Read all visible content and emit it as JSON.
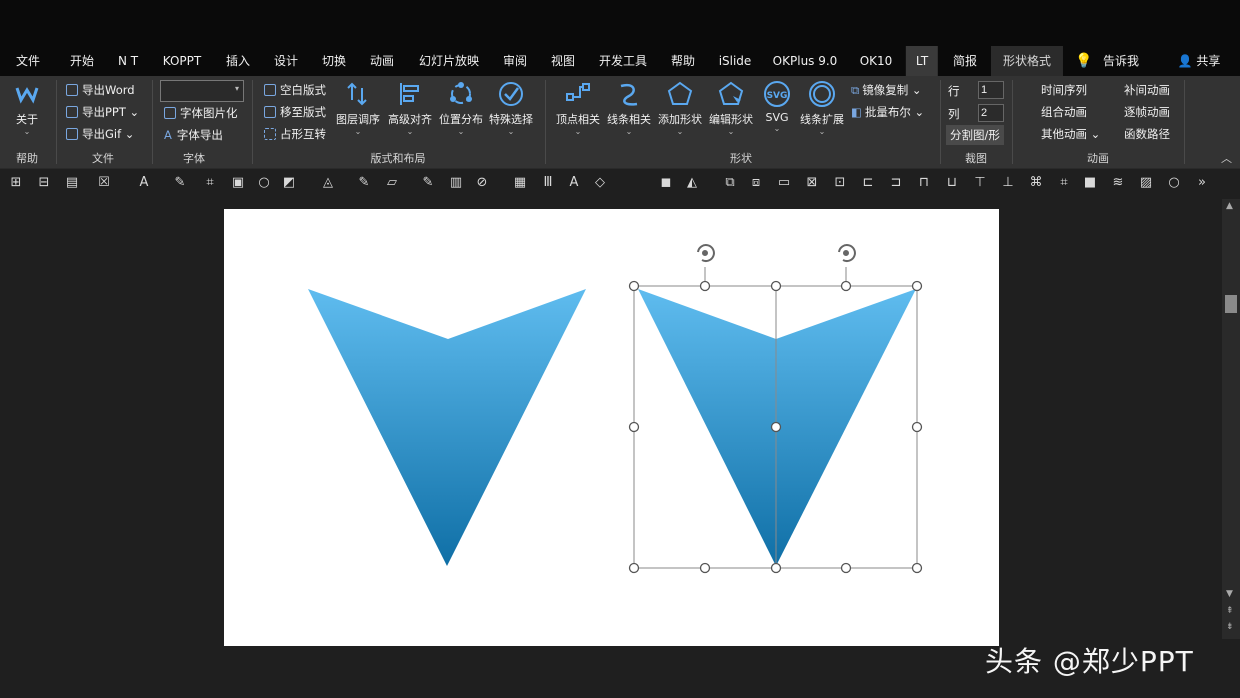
{
  "tabs": [
    "文件",
    "开始",
    "N T",
    "KOPPT",
    "插入",
    "设计",
    "切换",
    "动画",
    "幻灯片放映",
    "审阅",
    "视图",
    "开发工具",
    "帮助",
    "iSlide",
    "OKPlus 9.0",
    "OK10",
    "LT",
    "简报",
    "形状格式",
    "告诉我",
    "共享"
  ],
  "ribbon": {
    "help_group": {
      "about": "关于",
      "label": "帮助"
    },
    "file_group": {
      "export_word": "导出Word",
      "export_ppt": "导出PPT",
      "export_gif": "导出Gif",
      "label": "文件"
    },
    "font_group": {
      "font_image": "字体图片化",
      "font_export": "字体导出",
      "label": "字体"
    },
    "layout_group": {
      "blank_layout": "空白版式",
      "move_layout": "移至版式",
      "placeholder_swap": "占形互转",
      "layer_order": "图层调序",
      "advanced_align": "高级对齐",
      "position_dist": "位置分布",
      "special_select": "特殊选择",
      "label": "版式和布局"
    },
    "shape_group": {
      "vertex": "顶点相关",
      "line": "线条相关",
      "add_shape": "添加形状",
      "edit_shape": "编辑形状",
      "svg": "SVG",
      "line_expand": "线条扩展",
      "mirror_copy": "镜像复制",
      "batch_boolean": "批量布尔",
      "label": "形状"
    },
    "crop_group": {
      "row_label": "行",
      "row_value": "1",
      "col_label": "列",
      "col_value": "2",
      "split": "分割图/形",
      "label": "裁图"
    },
    "anim_group": {
      "time_seq": "时间序列",
      "tween": "补间动画",
      "combo": "组合动画",
      "frame": "逐帧动画",
      "other": "其他动画",
      "func_path": "函数路径",
      "label": "动画"
    }
  },
  "colors": {
    "gradient_top": "#5fbcef",
    "gradient_bottom": "#0f6fa6",
    "ribbon_bg": "#333333"
  },
  "watermark": "头条 @郑少PPT"
}
